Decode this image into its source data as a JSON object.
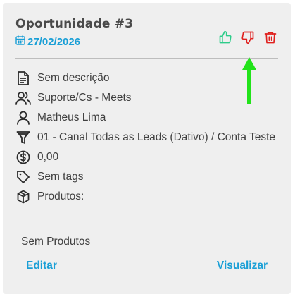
{
  "card": {
    "title": "Oportunidade #3",
    "date": "27/02/2026",
    "description": "Sem descrição",
    "team": "Suporte/Cs - Meets",
    "owner": "Matheus Lima",
    "funnel": "01 - Canal Todas as Leads (Dativo) / Conta Teste",
    "value": "0,00",
    "tags": "Sem tags",
    "products_label": "Produtos:",
    "products_empty": "Sem Produtos",
    "edit_label": "Editar",
    "view_label": "Visualizar"
  },
  "icons": {
    "date": "calendar-icon",
    "like": "thumbs-up-icon",
    "dislike": "thumbs-down-icon",
    "delete": "trash-icon",
    "description": "document-icon",
    "team": "users-icon",
    "owner": "user-icon",
    "funnel": "funnel-icon",
    "value": "dollar-circle-icon",
    "tags": "tag-icon",
    "products": "box-icon",
    "annotation": "arrow-up-icon"
  },
  "colors": {
    "accent": "#1a9fd6",
    "like": "#2ecc8a",
    "dislike": "#e0201e",
    "arrow": "#22e31a"
  }
}
